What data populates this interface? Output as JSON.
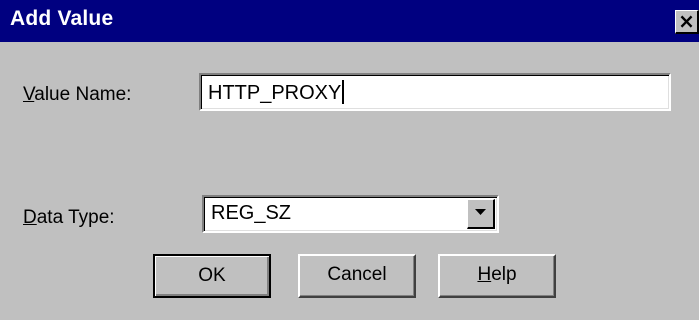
{
  "window": {
    "title": "Add Value",
    "close_glyph": "×"
  },
  "value_name": {
    "label_mnemonic": "V",
    "label_rest": "alue Name:",
    "value": "HTTP_PROXY"
  },
  "data_type": {
    "label_mnemonic": "D",
    "label_rest": "ata Type:",
    "selected": "REG_SZ"
  },
  "buttons": {
    "ok": "OK",
    "cancel": "Cancel",
    "help_mnemonic": "H",
    "help_rest": "elp"
  },
  "colors": {
    "titlebar": "#000080",
    "face": "#c0c0c0",
    "field": "#ffffff"
  }
}
